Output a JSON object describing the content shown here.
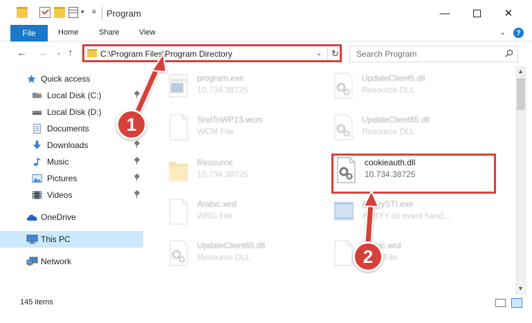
{
  "window": {
    "title": "Program",
    "minimize_glyph": "—",
    "close_glyph": "✕"
  },
  "ribbon": {
    "file_tab": "File",
    "tabs": [
      "Home",
      "Share",
      "View"
    ],
    "help_glyph": "?"
  },
  "navigation": {
    "back_glyph": "←",
    "forward_glyph": "→",
    "up_glyph": "↑",
    "refresh_glyph": "↻"
  },
  "address_bar": {
    "path": "C:\\Program Files\\Program Directory"
  },
  "search": {
    "placeholder": "Search Program"
  },
  "sidebar": {
    "items": [
      {
        "label": "Quick access",
        "icon": "star-icon",
        "pinned": false
      },
      {
        "label": "Local Disk (C:)",
        "icon": "drive-icon",
        "pinned": true
      },
      {
        "label": "Local Disk (D:)",
        "icon": "drive-icon",
        "pinned": false
      },
      {
        "label": "Documents",
        "icon": "documents-icon",
        "pinned": true
      },
      {
        "label": "Downloads",
        "icon": "download-arrow-icon",
        "pinned": true
      },
      {
        "label": "Music",
        "icon": "music-note-icon",
        "pinned": true
      },
      {
        "label": "Pictures",
        "icon": "pictures-icon",
        "pinned": true
      },
      {
        "label": "Videos",
        "icon": "videos-icon",
        "pinned": true
      },
      {
        "label": "OneDrive",
        "icon": "cloud-icon",
        "pinned": false
      },
      {
        "label": "This PC",
        "icon": "monitor-icon",
        "pinned": false,
        "selected": true
      },
      {
        "label": "Network",
        "icon": "network-icon",
        "pinned": false
      }
    ]
  },
  "files": [
    {
      "name": "program.exe",
      "detail": "10.734.38725",
      "icon": "exe-icon",
      "faded": true
    },
    {
      "name": "UpdateClient5.dll",
      "detail": "Resource DLL",
      "icon": "dll-gear-icon",
      "faded": true
    },
    {
      "name": "SndToWP13.wcm",
      "detail": "WCM File",
      "icon": "blank-file-icon",
      "faded": true
    },
    {
      "name": "UpdateClient65.dll",
      "detail": "Resource DLL",
      "icon": "dll-gear-icon",
      "faded": true
    },
    {
      "name": "Resource",
      "detail": "10.734.38725",
      "icon": "folder-icon",
      "faded": true
    },
    {
      "name": "cookieauth.dll",
      "detail": "10.734.38725",
      "icon": "dll-gear-icon",
      "faded": false
    },
    {
      "name": "Arabic.wrd",
      "detail": "WRD File",
      "icon": "blank-file-icon",
      "faded": true
    },
    {
      "name": "AbbyySTI.exe",
      "detail": "ABBYY sti event hand...",
      "icon": "exe-icon",
      "faded": true
    },
    {
      "name": "UpdateClient65.dll",
      "detail": "Resource DLL",
      "icon": "dll-gear-icon",
      "faded": true
    },
    {
      "name": "Arabic.wrd",
      "detail": "WRD File",
      "icon": "blank-file-icon",
      "faded": true
    }
  ],
  "status": {
    "item_count": "145 items"
  },
  "callouts": [
    "1",
    "2"
  ],
  "colors": {
    "accent": "#1979ca",
    "highlight": "#d6413a",
    "selection": "#cce8ff"
  }
}
